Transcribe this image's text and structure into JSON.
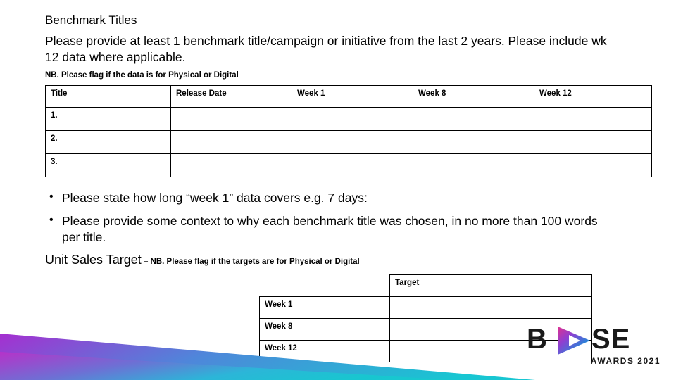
{
  "slide": {
    "heading": "Benchmark Titles",
    "intro": "Please provide at least 1 benchmark title/campaign or initiative from the last 2 years. Please include wk 12 data where applicable.",
    "nb_note": "NB. Please flag if the data is for Physical or Digital",
    "benchmark_table": {
      "headers": [
        "Title",
        "Release Date",
        "Week 1",
        "Week 8",
        "Week 12"
      ],
      "rows": [
        [
          "1.",
          "",
          "",
          "",
          ""
        ],
        [
          "2.",
          "",
          "",
          "",
          ""
        ],
        [
          "3.",
          "",
          "",
          "",
          ""
        ]
      ]
    },
    "bullets": [
      "Please state how long “week 1” data covers e.g. 7 days:",
      "Please provide some context to why each benchmark title was chosen, in no more than 100 words per title."
    ],
    "unit_sales": {
      "title": "Unit Sales Target",
      "dash": " – ",
      "note": "NB. Please flag if the targets are for Physical or Digital"
    },
    "target_table": {
      "header": [
        "",
        "Target"
      ],
      "rows": [
        [
          "Week 1",
          ""
        ],
        [
          "Week 8",
          ""
        ],
        [
          "Week 12",
          ""
        ]
      ]
    },
    "logo": {
      "text_left": "B",
      "text_right": "SE",
      "subtitle": "AWARDS 2021"
    },
    "colors": {
      "ribbon_magenta": "#b931c8",
      "ribbon_cyan": "#1dc4d6",
      "logo_dark": "#1a1a1a",
      "border": "#000000"
    }
  }
}
